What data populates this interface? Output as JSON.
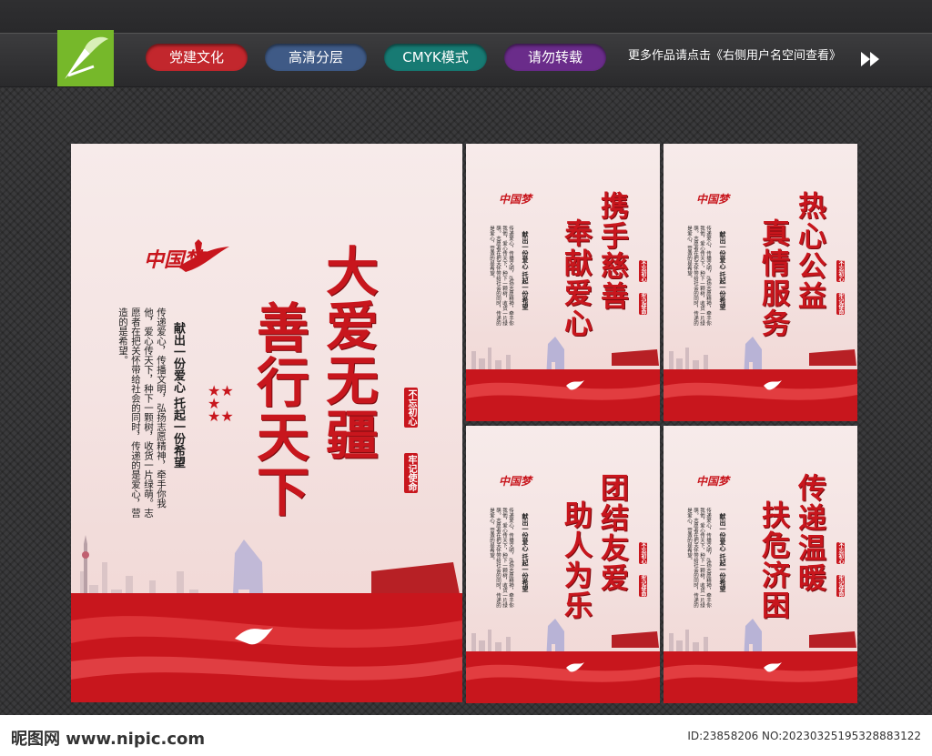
{
  "header": {
    "tags": [
      "党建文化",
      "高清分层",
      "CMYK模式",
      "请勿转载"
    ],
    "tag_colors": [
      "#c2272d",
      "#3f5a86",
      "#177a73",
      "#6a2c8a"
    ],
    "note": "更多作品请点击《右侧用户名空间查看》"
  },
  "main_poster": {
    "title_line1": "大爱无疆",
    "title_line2": "善行天下",
    "logo_text": "中国梦",
    "subtitle": "献出一份爱心 托起一份希望",
    "seal_line1": "不忘初心",
    "seal_line2": "牢记使命",
    "body_text": "传递爱心，传播文明，弘扬志愿精神，牵手你我他，爱心传天下，种下一颗树，收货一片绿萌。志愿者在把关怀带给社会的同时，传递的是爱心，营造的是希望。"
  },
  "small_posters": [
    {
      "title_line1": "携手慈善",
      "title_line2": "奉献爱心"
    },
    {
      "title_line1": "热心公益",
      "title_line2": "真情服务"
    },
    {
      "title_line1": "团结友爱",
      "title_line2": "助人为乐"
    },
    {
      "title_line1": "传递温暖",
      "title_line2": "扶危济困"
    }
  ],
  "footer": {
    "brand": "昵图网 www.nipic.com",
    "id": "ID:23858206 NO:20230325195328883122"
  },
  "colors": {
    "accent_red": "#c8161d",
    "logo_green": "#76b82a"
  }
}
